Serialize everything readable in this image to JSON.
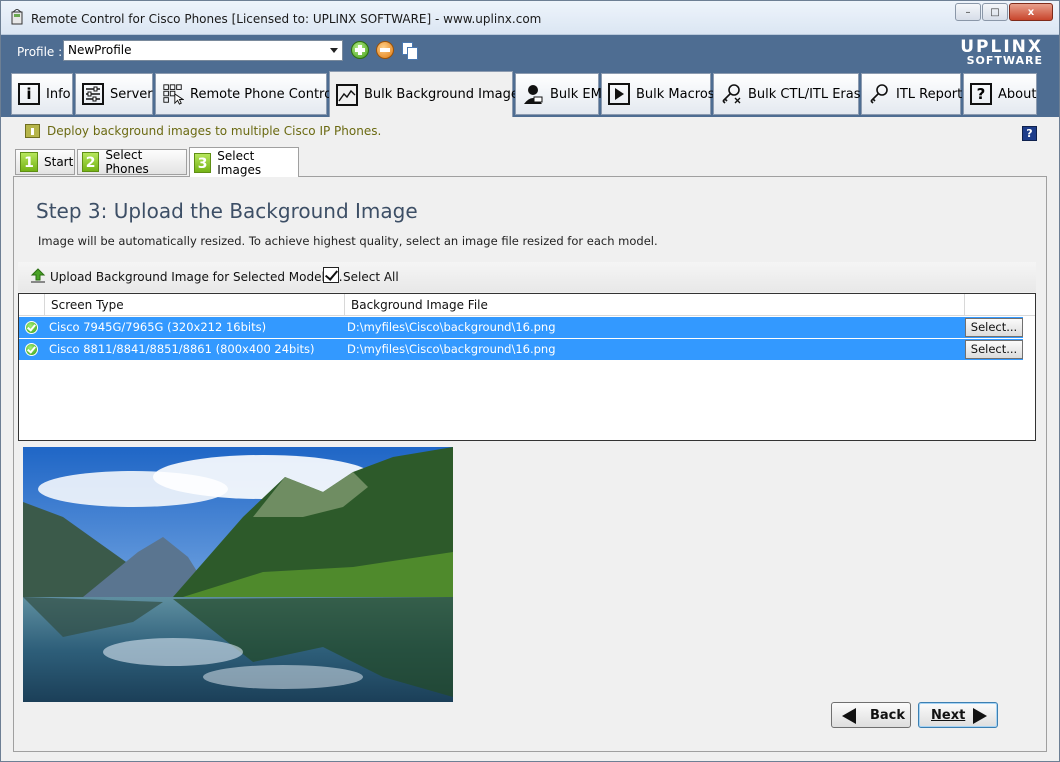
{
  "window": {
    "title": "Remote Control for Cisco Phones [Licensed to: UPLINX SOFTWARE] - www.uplinx.com",
    "minimize": "–",
    "maximize": "□",
    "close": "x"
  },
  "header": {
    "profile_label": "Profile :",
    "profile_value": "NewProfile",
    "logo_line1": "UPLINX",
    "logo_line2": "SOFTWARE"
  },
  "main_tabs": [
    {
      "label": "Info",
      "icon": "info-icon",
      "glyph": "i"
    },
    {
      "label": "Server",
      "icon": "server-settings-icon"
    },
    {
      "label": "Remote Phone Control",
      "icon": "keypad-icon"
    },
    {
      "label": "Bulk Background Images",
      "icon": "image-chart-icon",
      "active": true
    },
    {
      "label": "Bulk EM",
      "icon": "user-icon"
    },
    {
      "label": "Bulk Macros",
      "icon": "macro-play-icon"
    },
    {
      "label": "Bulk CTL/ITL Erase",
      "icon": "key-erase-icon"
    },
    {
      "label": "ITL Report",
      "icon": "key-icon"
    },
    {
      "label": "About",
      "icon": "help-icon",
      "glyph": "?"
    }
  ],
  "hint": {
    "text": "Deploy background images to multiple Cisco IP Phones.",
    "help_glyph": "?"
  },
  "step_tabs": [
    {
      "num": "1",
      "label": "Start"
    },
    {
      "num": "2",
      "label": "Select Phones"
    },
    {
      "num": "3",
      "label": "Select Images",
      "active": true
    }
  ],
  "step": {
    "heading": "Step 3: Upload the Background Image",
    "description": "Image will be automatically resized. To achieve highest quality, select an image file resized for each model."
  },
  "toolbar": {
    "upload_label": "Upload Background Image for Selected Models...",
    "select_all_label": "Select All",
    "select_all_checked": true
  },
  "grid": {
    "columns": [
      "Screen Type",
      "Background Image File"
    ],
    "rows": [
      {
        "screen_type": "Cisco 7945G/7965G (320x212 16bits)",
        "file": "D:\\myfiles\\Cisco\\background\\16.png",
        "button": "Select..."
      },
      {
        "screen_type": "Cisco 8811/8841/8851/8861 (800x400 24bits)",
        "file": "D:\\myfiles\\Cisco\\background\\16.png",
        "button": "Select..."
      }
    ]
  },
  "nav": {
    "back_label": "Back",
    "next_label": "Next"
  },
  "colors": {
    "header_bg": "#4e6d92",
    "selection": "#3399ff",
    "step_green": "#75b317"
  }
}
